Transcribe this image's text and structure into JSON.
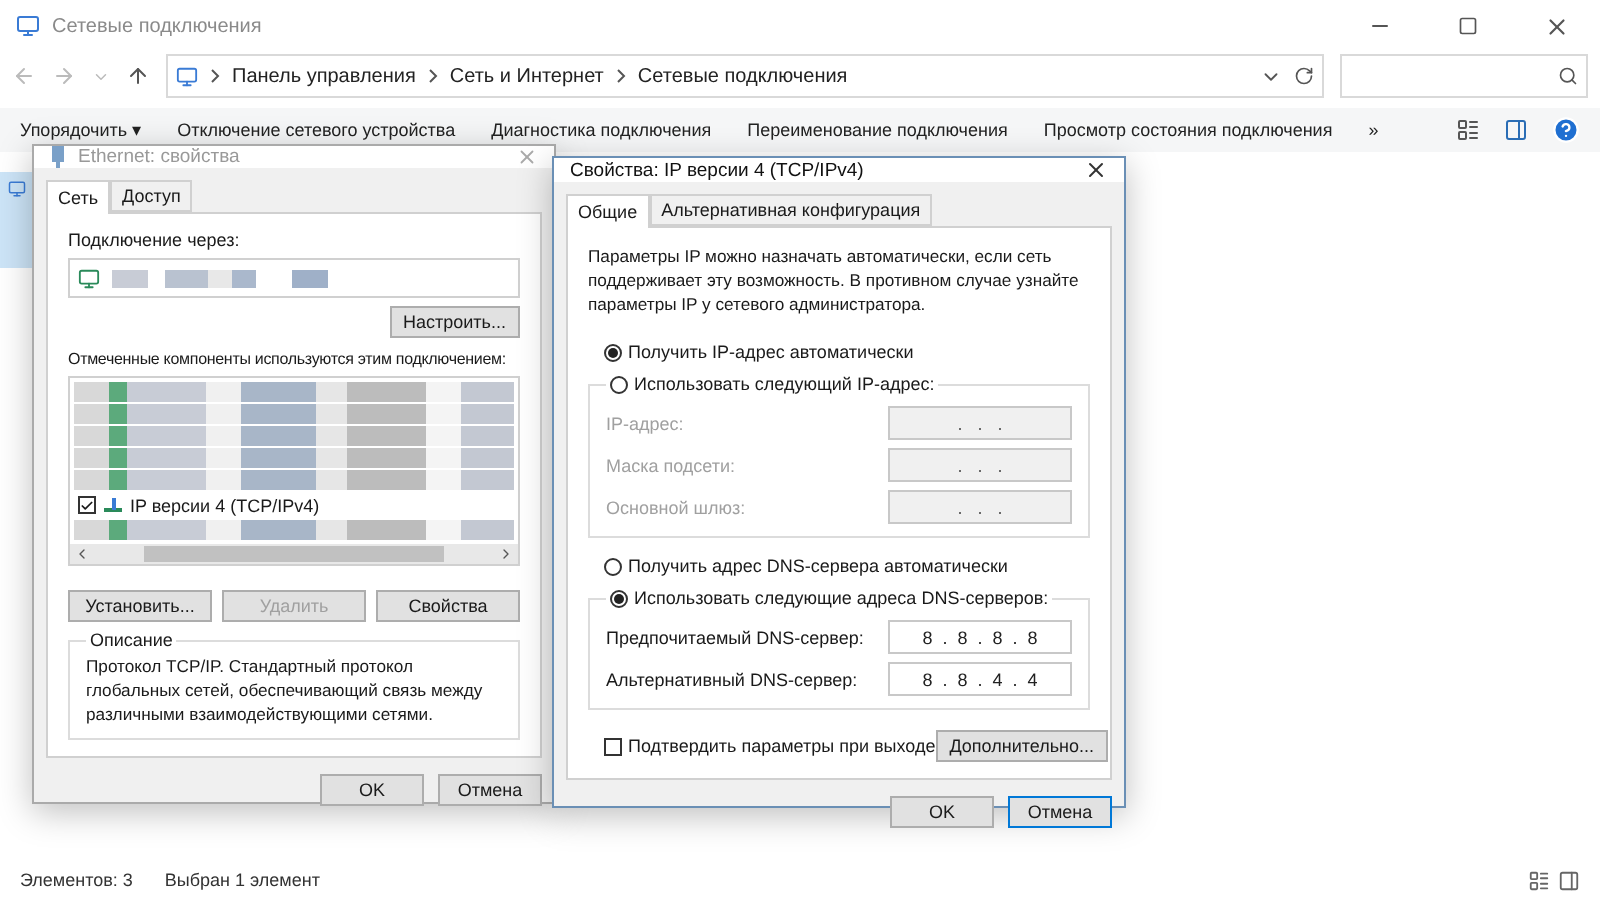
{
  "window": {
    "title": "Сетевые подключения"
  },
  "breadcrumbs": [
    "Панель управления",
    "Сеть и Интернет",
    "Сетевые подключения"
  ],
  "toolbar": {
    "items": [
      "Упорядочить ▾",
      "Отключение сетевого устройства",
      "Диагностика подключения",
      "Переименование подключения",
      "Просмотр состояния подключения"
    ],
    "overflow": "»"
  },
  "status_bar": {
    "count": "Элементов: 3",
    "selection": "Выбран 1 элемент"
  },
  "ethernet_dialog": {
    "title": "Ethernet: свойства",
    "active": false,
    "tabs": [
      {
        "label": "Сеть",
        "selected": true
      },
      {
        "label": "Доступ",
        "selected": false
      }
    ],
    "connect_label": "Подключение через:",
    "configure_button": "Настроить...",
    "components_label": "Отмеченные компоненты используются этим подключением:",
    "components": [
      {
        "kind": "redacted"
      },
      {
        "kind": "redacted"
      },
      {
        "kind": "redacted"
      },
      {
        "kind": "redacted"
      },
      {
        "kind": "redacted"
      },
      {
        "kind": "item",
        "label": "IP версии 4 (TCP/IPv4)",
        "checked": true
      },
      {
        "kind": "redacted"
      }
    ],
    "buttons": [
      {
        "label": "Установить...",
        "disabled": false
      },
      {
        "label": "Удалить",
        "disabled": true
      },
      {
        "label": "Свойства",
        "disabled": false
      }
    ],
    "description": {
      "title": "Описание",
      "text": "Протокол TCP/IP. Стандартный протокол глобальных сетей, обеспечивающий связь между различными взаимодействующими сетями."
    },
    "footer": [
      {
        "label": "OK",
        "focused": false
      },
      {
        "label": "Отмена",
        "focused": false
      }
    ]
  },
  "ipv4_dialog": {
    "title": "Свойства: IP версии 4 (TCP/IPv4)",
    "active": true,
    "tabs": [
      {
        "label": "Общие",
        "selected": true
      },
      {
        "label": "Альтернативная конфигурация",
        "selected": false
      }
    ],
    "intro": "Параметры IP можно назначать автоматически, если сеть поддерживает эту возможность. В противном случае узнайте параметры IP у сетевого администратора.",
    "ip_auto": {
      "label": "Получить IP-адрес автоматически",
      "selected": true
    },
    "ip_manual": {
      "label": "Использовать следующий IP-адрес:",
      "selected": false,
      "fields": [
        {
          "label": "IP-адрес:",
          "value": ".   .   .",
          "disabled": true
        },
        {
          "label": "Маска подсети:",
          "value": ".   .   .",
          "disabled": true
        },
        {
          "label": "Основной шлюз:",
          "value": ".   .   .",
          "disabled": true
        }
      ]
    },
    "dns_auto": {
      "label": "Получить адрес DNS-сервера автоматически",
      "selected": false
    },
    "dns_manual": {
      "label": "Использовать следующие адреса DNS-серверов:",
      "selected": true,
      "fields": [
        {
          "label": "Предпочитаемый DNS-сервер:",
          "value": "8  .  8  .  8  .  8",
          "disabled": false
        },
        {
          "label": "Альтернативный DNS-сервер:",
          "value": "8  .  8  .  4  .  4",
          "disabled": false
        }
      ]
    },
    "validate": {
      "label": "Подтвердить параметры при выходе",
      "checked": false
    },
    "advanced_button": "Дополнительно...",
    "footer": [
      {
        "label": "OK",
        "focused": false
      },
      {
        "label": "Отмена",
        "focused": true
      }
    ]
  }
}
